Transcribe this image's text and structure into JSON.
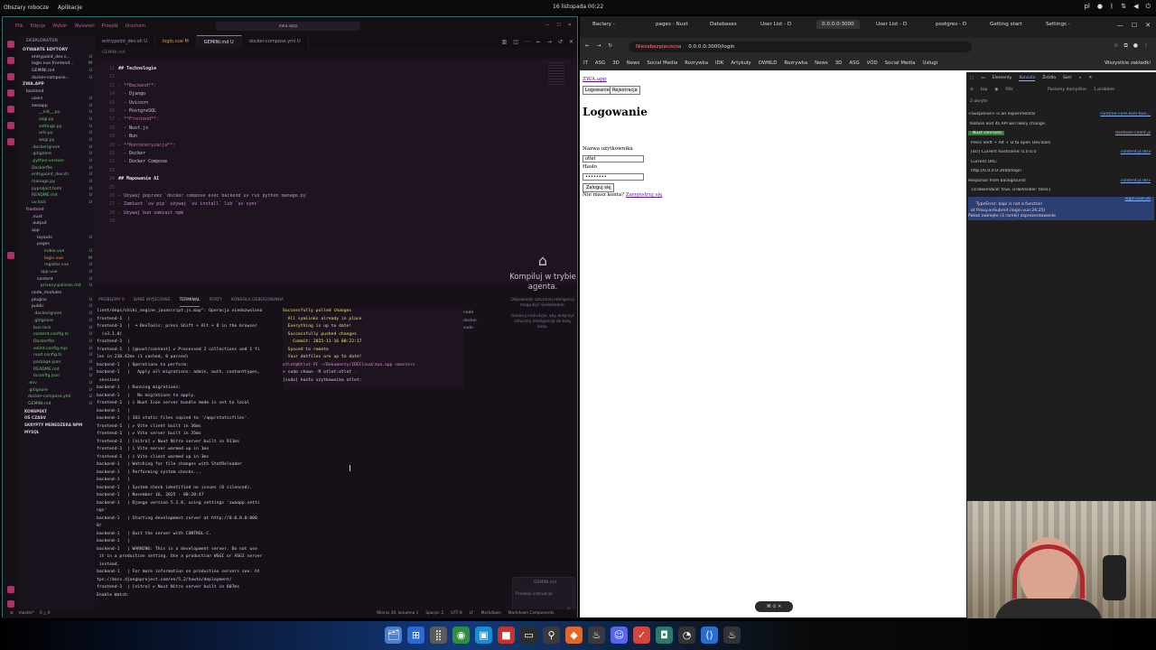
{
  "os": {
    "left": [
      "Obszary robocze",
      "Aplikacje"
    ],
    "clock": "16 listopada 00:22",
    "tray_icons": [
      "pl-keyboard-icon",
      "mic-icon",
      "bluetooth-icon",
      "network-icon",
      "volume-icon",
      "power-icon"
    ]
  },
  "vscode": {
    "menu": [
      "Plik",
      "Edycja",
      "Wybór",
      "Wyświetl",
      "Przejdź",
      "Uruchom"
    ],
    "search": "zwa.app",
    "explorer_header": "EKSPLORATOR",
    "open_editors_label": "OTWARTE EDYTORY",
    "open_editors": [
      {
        "name": "entrypoint_dev.s...",
        "st": "U"
      },
      {
        "name": "login.vue frontend...",
        "st": "M"
      },
      {
        "name": "GEMINI.md",
        "st": "U"
      },
      {
        "name": "docker-compose...",
        "st": "U"
      }
    ],
    "project_label": "ZWA.APP",
    "tree": [
      {
        "name": "backend",
        "st": ""
      },
      {
        "name": "users",
        "st": "U"
      },
      {
        "name": "zwaapp",
        "st": "U"
      },
      {
        "name": "__init__.py",
        "st": "U"
      },
      {
        "name": "asgi.py",
        "st": "U"
      },
      {
        "name": "settings.py",
        "st": "U"
      },
      {
        "name": "urls.py",
        "st": "U"
      },
      {
        "name": "wsgi.py",
        "st": "U"
      },
      {
        "name": ".dockerignore",
        "st": "U"
      },
      {
        "name": ".gitignore",
        "st": "U"
      },
      {
        "name": ".python-version",
        "st": "U"
      },
      {
        "name": "Dockerfile",
        "st": "U"
      },
      {
        "name": "entrypoint_dev.sh",
        "st": "U"
      },
      {
        "name": "manage.py",
        "st": "U"
      },
      {
        "name": "pyproject.toml",
        "st": "U"
      },
      {
        "name": "README.md",
        "st": "U"
      },
      {
        "name": "uv.lock",
        "st": "U"
      },
      {
        "name": "frontend",
        "st": ""
      },
      {
        "name": ".nuxt",
        "st": ""
      },
      {
        "name": ".output",
        "st": ""
      },
      {
        "name": "app",
        "st": ""
      },
      {
        "name": "layouts",
        "st": "U"
      },
      {
        "name": "pages",
        "st": ""
      },
      {
        "name": "index.vue",
        "st": "U"
      },
      {
        "name": "login.vue",
        "st": "M"
      },
      {
        "name": "register.vue",
        "st": "U"
      },
      {
        "name": "app.vue",
        "st": "U"
      },
      {
        "name": "content",
        "st": "U"
      },
      {
        "name": "privacy-policies.md",
        "st": "U"
      },
      {
        "name": "node_modules",
        "st": ""
      },
      {
        "name": "plugins",
        "st": "U"
      },
      {
        "name": "public",
        "st": "U"
      },
      {
        "name": ".dockerignore",
        "st": "U"
      },
      {
        "name": ".gitignore",
        "st": "U"
      },
      {
        "name": "bun.lock",
        "st": "U"
      },
      {
        "name": "content.config.ts",
        "st": "U"
      },
      {
        "name": "Dockerfile",
        "st": "U"
      },
      {
        "name": "eslint.config.mjs",
        "st": "U"
      },
      {
        "name": "nuxt.config.ts",
        "st": "U"
      },
      {
        "name": "package.json",
        "st": "U"
      },
      {
        "name": "README.md",
        "st": "U"
      },
      {
        "name": "tsconfig.json",
        "st": "U"
      },
      {
        "name": ".env",
        "st": "U"
      },
      {
        "name": ".gitignore",
        "st": "U"
      },
      {
        "name": "docker-compose.yml",
        "st": "U"
      },
      {
        "name": "GEMINI.md",
        "st": "U"
      }
    ],
    "bottom_sections": [
      "KONSPEKT",
      "OŚ CZASU",
      "SKRYPTY MENEDŻERA NPM",
      "MYSQL"
    ],
    "tabs": [
      "entrypoint_dev.sh U",
      "login.vue M",
      "GEMINI.md U",
      "docker-compose.yml U"
    ],
    "breadcrumb": "GEMINI.md",
    "code": [
      {
        "n": "11",
        "t": "## Technologie",
        "k": "h"
      },
      {
        "n": "12",
        "t": "",
        "k": ""
      },
      {
        "n": "13",
        "t": "- **Backend**:",
        "k": "b"
      },
      {
        "n": "14",
        "t": "  - Django",
        "k": ""
      },
      {
        "n": "15",
        "t": "  - Uvicorn",
        "k": ""
      },
      {
        "n": "16",
        "t": "  - PostgreSQL",
        "k": ""
      },
      {
        "n": "17",
        "t": "- **Frontend**:",
        "k": "b"
      },
      {
        "n": "18",
        "t": "  - Nuxt.js",
        "k": ""
      },
      {
        "n": "19",
        "t": "  - Bun",
        "k": ""
      },
      {
        "n": "20",
        "t": "- **Konteneryzacja**:",
        "k": "b"
      },
      {
        "n": "21",
        "t": "  - Docker",
        "k": ""
      },
      {
        "n": "22",
        "t": "  - Docker Compose",
        "k": ""
      },
      {
        "n": "23",
        "t": "",
        "k": ""
      },
      {
        "n": "24",
        "t": "## Mapowanie AI",
        "k": "h"
      },
      {
        "n": "25",
        "t": "",
        "k": ""
      },
      {
        "n": "26",
        "t": "- Używaj poprzez `docker compose exec backend uv run python manage.py`",
        "k": "c"
      },
      {
        "n": "27",
        "t": "- Zamiast `uv pip` używaj `uv install` lub `uv sync`",
        "k": "c"
      },
      {
        "n": "28",
        "t": "- Używaj bun zamiast npm",
        "k": "c"
      },
      {
        "n": "29",
        "t": "",
        "k": ""
      }
    ],
    "copilot_title": "Kompiluj w trybie agenta.",
    "copilot_sub": "Odpowiedzi sztucznej inteligencji mogą być niedokładne.",
    "copilot_sub2": "Generuj instrukcje, aby dołączyć sztuczną inteligencję do bazy kodu.",
    "chat_placeholder": "Przekaż instrukcje",
    "chat_file": "GEMINI.md",
    "panel_tabs": [
      "PROBLEMY",
      "DANE WYJŚCIOWE",
      "TERMINAL",
      "PORTY",
      "KONSOLA DEBUGOWANIA"
    ],
    "problems_count": "9",
    "terminal": [
      "lient/deps/shiki_engine_javascript.js.map\": Operacja niedozwolona",
      "",
      "frontend-1  |",
      "frontend-1  |  ➜ DevTools: press Shift + Alt + D in the browser",
      "  (v3.1.0)",
      "frontend-1  |",
      "frontend-1  | [@nuxt/content] ✔ Processed 2 collections and 1 fi",
      "les in 230.42ms (1 cached, 0 parsed)",
      "backend-1   | Operations to perform:",
      "backend-1   |   Apply all migrations: admin, auth, contenttypes,",
      " sessions",
      "backend-1   | Running migrations:",
      "backend-1   |   No migrations to apply.",
      "frontend-1  | i Nuxt Icon server bundle mode is set to local",
      "backend-1   |",
      "backend-1   | 163 static files copied to '/app/staticfiles'.",
      "frontend-1  | ✔ Vite client built in 36ms",
      "frontend-1  | ✔ Vite server built in 35ms",
      "frontend-1  | [nitro] ✔ Nuxt Nitro server built in 911ms",
      "frontend-1  | i Vite server warmed up in 1ms",
      "frontend-1  | i Vite client warmed up in 3ms",
      "backend-1   | Watching for file changes with StatReloader",
      "backend-1   | Performing system checks...",
      "backend-1   |",
      "backend-1   | System check identified no issues (0 silenced).",
      "backend-1   | November 16, 2025 - 00:20:47",
      "backend-1   | Django version 5.2.8, using settings 'zwaapp.setti",
      "ngs'",
      "backend-1   | Starting development server at http://0.0.0.0:800",
      "0/",
      "backend-1   | Quit the server with CONTROL-C.",
      "backend-1   |",
      "backend-1   | WARNING: This is a development server. Do not use",
      " it in a production setting. Use a production WSGI or ASGI server",
      " instead.",
      "backend-1   | For more information on production servers see: ht",
      "tps://docs.djangoproject.com/en/5.2/howto/deployment/",
      "frontend-1  | [nitro] ✔ Nuxt Nitro server built in 607ms",
      "",
      "Enable Watch"
    ],
    "terminal2": [
      "Successfully pulled changes",
      "  All symlinks already in place",
      "  Everything is up to date!",
      "  Successfully pushed changes",
      "    Commit: 2025-11-16 00:22:17",
      "  Synced to remote",
      "  Your dotfiles are up to date!",
      "otlet@Otlet-PC ~/Dokumenty/IDECloud/zwa.app <master>",
      "> sudo chown -R otlet:otlet .",
      "[sudo] hasło użytkownika otlet: "
    ],
    "term_list": [
      "node",
      "docker",
      "sudo"
    ],
    "status_left": [
      "master*",
      "0 △ 0"
    ],
    "status_right": [
      "Wiersz 30, kolumna 1",
      "Spacje: 2",
      "UTF-8",
      "LF",
      "Markdown",
      "Markdown Components"
    ]
  },
  "browser": {
    "tabs": [
      "Baclary -",
      "pages - Nuxt",
      "Databases",
      "User List - D",
      "0.0.0.0:3000",
      "User List - D",
      "postgres - D",
      "Getting start",
      "Settings -"
    ],
    "active_tab_index": 4,
    "insecure_label": "Niezabezpieczona",
    "url": "0.0.0.0:3000/login",
    "bookmarks": [
      "IT",
      "ASG",
      "3D",
      "News",
      "Social Media",
      "Rozrywka",
      "IDK",
      "Artykuły",
      "OWNLD",
      "Rozrywka",
      "News",
      "3D",
      "ASG",
      "VOD",
      "Social Media",
      "Usługi"
    ],
    "bookmarks_right": "Wszystkie zakładki",
    "page": {
      "brand": "ZWA.app",
      "nav_login": "Logowanie",
      "nav_register": "Rejestracja",
      "title": "Logowanie",
      "username_label": "Nazwa użytkownika",
      "username_value": "otlet",
      "password_label": "Hasło",
      "password_value": "••••••••",
      "submit": "Zaloguj się",
      "no_account": "Nie masz konta?",
      "register_link": "Zarejestruj się"
    },
    "devtools": {
      "tabs": [
        "Elementy",
        "Konsola",
        "Źródła",
        "Sieć"
      ],
      "active": "Konsola",
      "top": "top",
      "filter": "Filtr",
      "levels": "Poziomy domyślne",
      "issues": "1 problem",
      "hidden": "2 ukryte",
      "messages": [
        {
          "t": "<Suspense> is an experimental",
          "src": "runtime-core.esm-bun..."
        },
        {
          "t": " feature and its API will likely change.",
          "src": ""
        },
        {
          "t": "  Nuxt DevTools",
          "src": "devtools-client.js"
        },
        {
          "t": "  Press Shift + Alt + D to open DevTools",
          "src": ""
        },
        {
          "t": "  [ssr] Current hostname: 0.0.0.0",
          "src": "content.js:403"
        },
        {
          "t": "  Current URL:",
          "src": ""
        },
        {
          "t": "  http://0.0.0.0:3000/login",
          "src": ""
        },
        {
          "t": "Response from background:",
          "src": "content.js:407"
        },
        {
          "t": "  {isTokenValid: true, isTwlVisible: false}",
          "src": ""
        }
      ],
      "error": "TypeError: $api is not a function\n  at Proxy.onSubmit (login.vue:26:25)\nPokaż zwinięte (3 ramki) zaprezentowanie",
      "error_src": "login.vue:26"
    }
  },
  "overlay_pill": "⌘ ⊙ ✕",
  "taskbar_icons": [
    "file-manager-icon",
    "windows-icon",
    "apps-grid-icon",
    "chrome-icon",
    "folder-icon",
    "red-app-icon",
    "terminal-icon",
    "plug-icon",
    "git-icon",
    "steam-icon",
    "discord-icon",
    "todo-icon",
    "monitor-icon",
    "github-icon",
    "vscode-icon",
    "steam2-icon"
  ]
}
